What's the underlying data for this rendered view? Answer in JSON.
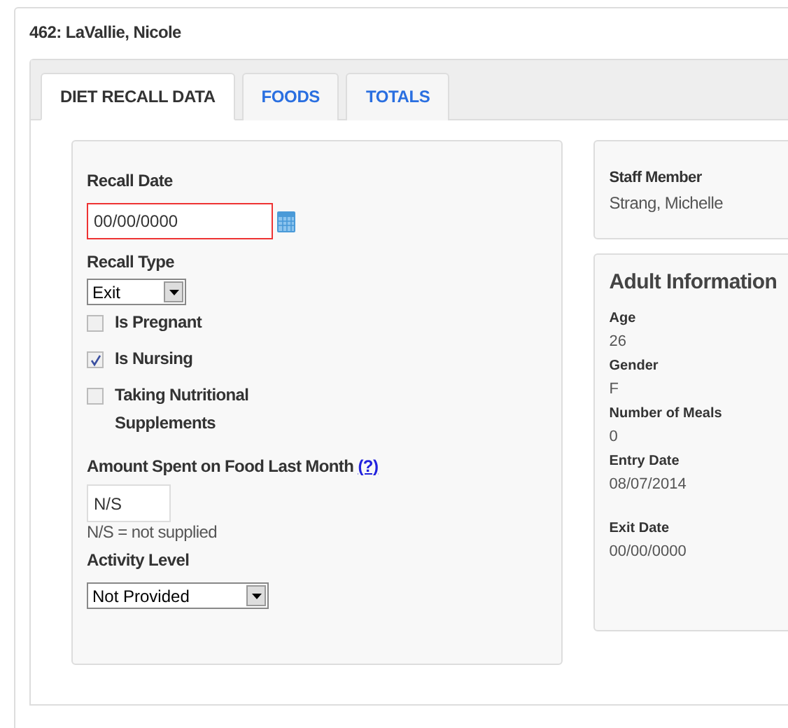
{
  "header": {
    "title": "462: LaVallie, Nicole"
  },
  "tabs": [
    {
      "label": "DIET RECALL DATA",
      "selected": true
    },
    {
      "label": "FOODS",
      "selected": false
    },
    {
      "label": "TOTALS",
      "selected": false
    }
  ],
  "form": {
    "recall_date": {
      "label": "Recall Date",
      "value": "00/00/0000",
      "invalid": true
    },
    "recall_type": {
      "label": "Recall Type",
      "value": "Exit"
    },
    "checkboxes": [
      {
        "label": "Is Pregnant",
        "checked": false
      },
      {
        "label": "Is Nursing",
        "checked": true
      },
      {
        "label": "Taking Nutritional Supplements",
        "checked": false
      }
    ],
    "amount_spent": {
      "label": "Amount Spent on Food Last Month",
      "help_link": "(?)",
      "value": "N/S",
      "note": "N/S = not supplied"
    },
    "activity_level": {
      "label": "Activity Level",
      "value": "Not Provided"
    }
  },
  "staff": {
    "label": "Staff Member",
    "value": "Strang, Michelle"
  },
  "adult_information": {
    "title": "Adult Information",
    "fields": [
      {
        "label": "Age",
        "value": "26",
        "gap_before": false
      },
      {
        "label": "Gender",
        "value": "F",
        "gap_before": false
      },
      {
        "label": "Number of Meals",
        "value": "0",
        "gap_before": false
      },
      {
        "label": "Entry Date",
        "value": "08/07/2014",
        "gap_before": false
      },
      {
        "label": "Exit Date",
        "value": "00/00/0000",
        "gap_before": true
      }
    ]
  }
}
